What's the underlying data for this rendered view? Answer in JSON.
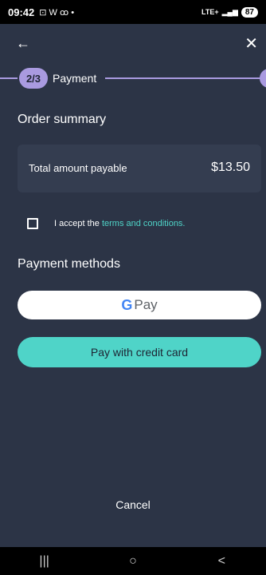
{
  "status_bar": {
    "time": "09:42",
    "left_icons": "⊡ W ꝏ •",
    "network": "LTE+",
    "signal": "▂▄▆",
    "battery": "87"
  },
  "header": {
    "back_glyph": "←",
    "close_glyph": "✕"
  },
  "stepper": {
    "step": "2/3",
    "label": "Payment"
  },
  "order_summary": {
    "title": "Order summary",
    "total_label": "Total amount payable",
    "total_value": "$13.50"
  },
  "terms": {
    "prefix": "I accept the ",
    "link": "terms and conditions."
  },
  "payment_methods": {
    "title": "Payment methods",
    "gpay_label": "Pay",
    "card_label": "Pay with credit card"
  },
  "cancel_label": "Cancel",
  "nav": {
    "recents": "|||",
    "home": "○",
    "back": "<"
  },
  "colors": {
    "background": "#2c3446",
    "accent": "#4fd4c8",
    "stepper": "#a99ae0",
    "card": "#343d50"
  }
}
